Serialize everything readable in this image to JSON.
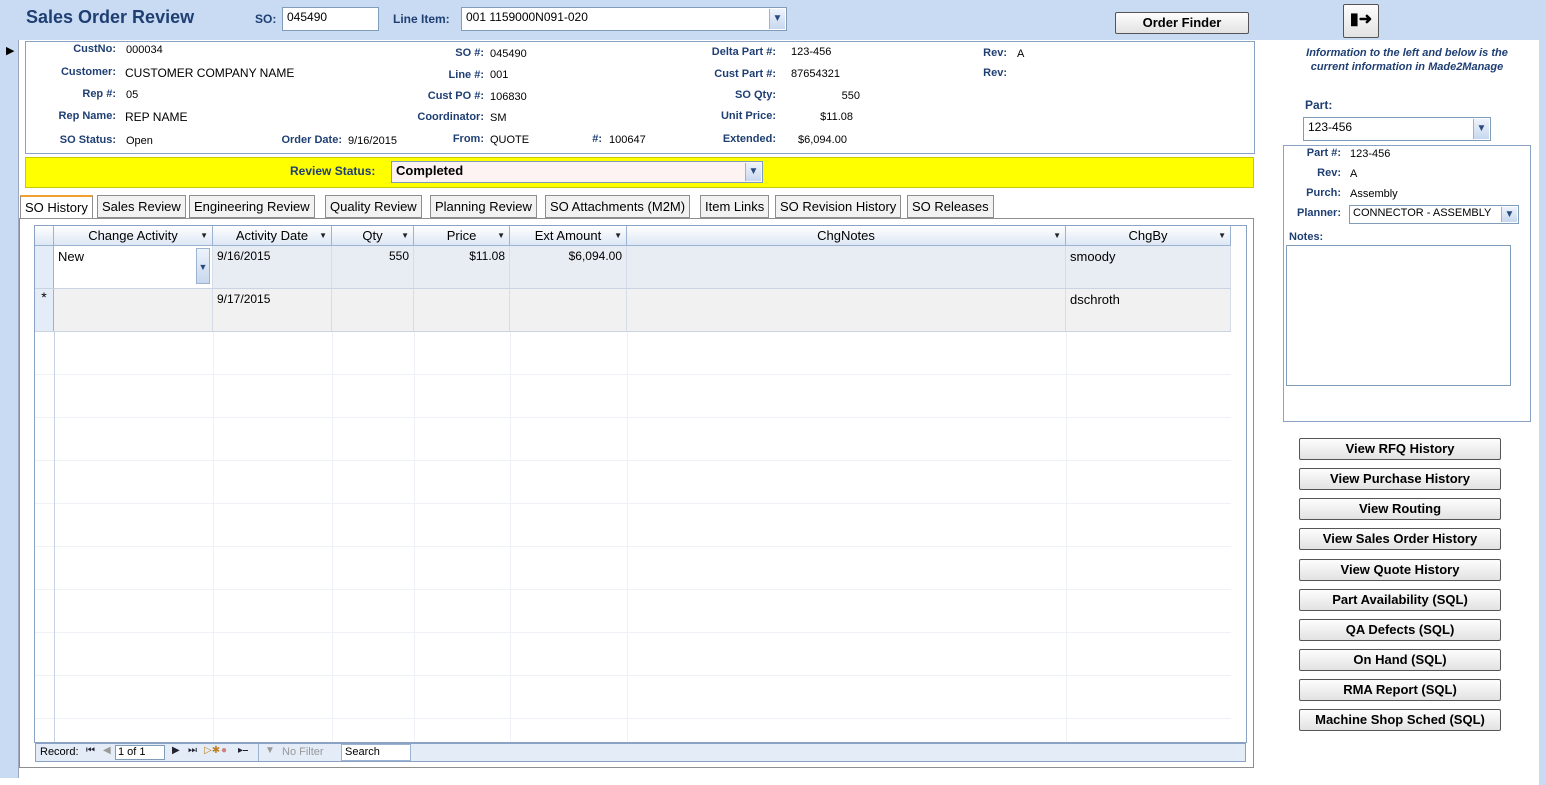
{
  "header": {
    "title": "Sales Order Review",
    "so_label": "SO:",
    "so_value": "045490",
    "line_item_label": "Line Item:",
    "line_item_value": "001 1159000N091-020",
    "order_finder_label": "Order Finder",
    "exit_icon": "exit-door-icon"
  },
  "info": {
    "custno_label": "CustNo:",
    "custno": "000034",
    "customer_label": "Customer:",
    "customer": "CUSTOMER COMPANY NAME",
    "rep_label": "Rep #:",
    "rep": "05",
    "rep_name_label": "Rep Name:",
    "rep_name": "REP NAME",
    "so_status_label": "SO Status:",
    "so_status": "Open",
    "order_date_label": "Order Date:",
    "order_date": "9/16/2015",
    "so_num_label": "SO #:",
    "so_num": "045490",
    "line_num_label": "Line #:",
    "line_num": "001",
    "cust_po_label": "Cust PO #:",
    "cust_po": "106830",
    "coordinator_label": "Coordinator:",
    "coordinator": "SM",
    "from_label": "From:",
    "from": "QUOTE",
    "quote_num_label": "#:",
    "quote_num": "100647",
    "delta_part_label": "Delta Part #:",
    "delta_part": "123-456",
    "cust_part_label": "Cust Part #:",
    "cust_part": "87654321",
    "so_qty_label": "SO Qty:",
    "so_qty": "550",
    "unit_price_label": "Unit Price:",
    "unit_price": "$11.08",
    "extended_label": "Extended:",
    "extended": "$6,094.00",
    "rev1_label": "Rev:",
    "rev1": "A",
    "rev2_label": "Rev:",
    "rev2": ""
  },
  "review": {
    "label": "Review Status:",
    "value": "Completed"
  },
  "tabs": [
    {
      "label": "SO History"
    },
    {
      "label": "Sales Review"
    },
    {
      "label": "Engineering Review"
    },
    {
      "label": "Quality Review"
    },
    {
      "label": "Planning Review"
    },
    {
      "label": "SO Attachments (M2M)"
    },
    {
      "label": "Item Links"
    },
    {
      "label": "SO Revision History"
    },
    {
      "label": "SO Releases"
    }
  ],
  "grid": {
    "columns": [
      "Change Activity",
      "Activity Date",
      "Qty",
      "Price",
      "Ext Amount",
      "ChgNotes",
      "ChgBy"
    ],
    "rows": [
      {
        "activity": "New",
        "date": "9/16/2015",
        "qty": "550",
        "price": "$11.08",
        "ext": "$6,094.00",
        "notes": "",
        "by": "smoody"
      },
      {
        "activity": "",
        "date": "9/17/2015",
        "qty": "",
        "price": "",
        "ext": "",
        "notes": "",
        "by": "dschroth"
      }
    ],
    "new_row_marker": "*"
  },
  "nav": {
    "record_label": "Record:",
    "record_value": "1 of 1",
    "filter_label": "No Filter",
    "search_label": "Search"
  },
  "side": {
    "info_text": "Information to the left and below is the current information in Made2Manage",
    "part_label": "Part:",
    "part_value": "123-456",
    "part_num_label": "Part #:",
    "part_num": "123-456",
    "rev_label": "Rev:",
    "rev": "A",
    "purch_label": "Purch:",
    "purch": "Assembly",
    "planner_label": "Planner:",
    "planner": "CONNECTOR - ASSEMBLY",
    "notes_label": "Notes:",
    "buttons": [
      {
        "label": "View RFQ History"
      },
      {
        "label": "View Purchase History"
      },
      {
        "label": "View Routing"
      },
      {
        "label": "View Sales Order History"
      },
      {
        "label": "View Quote History"
      },
      {
        "label": "Part Availability (SQL)"
      },
      {
        "label": "QA Defects (SQL)"
      },
      {
        "label": "On Hand (SQL)"
      },
      {
        "label": "RMA Report  (SQL)"
      },
      {
        "label": "Machine Shop Sched (SQL)"
      }
    ]
  },
  "colors": {
    "header_bg": "#c9dbf2",
    "title": "#1f3f73",
    "review_bar": "#ffff00"
  }
}
